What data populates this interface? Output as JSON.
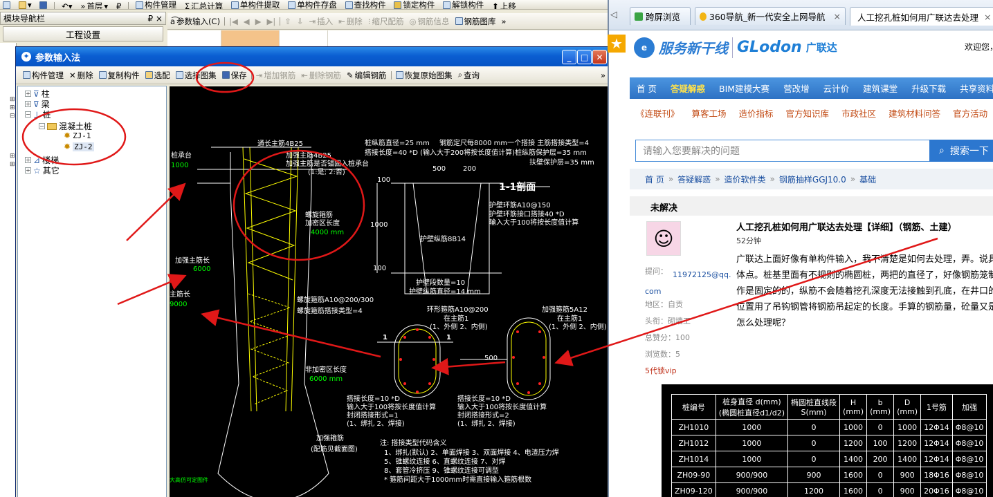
{
  "app_toolbar": {
    "floor": "首层",
    "items": [
      "构件管理",
      "汇总计算",
      "单构件提取",
      "单构件存盘",
      "查找构件",
      "锁定构件",
      "解锁构件",
      "上移"
    ]
  },
  "nav": {
    "title": "模块导航栏",
    "pin": "₽ ×",
    "project_settings": "工程设置"
  },
  "doc_toolbar": {
    "param_input": "参数输入(C)",
    "insert": "插入",
    "delete": "删除",
    "zoom": "缩尺配筋",
    "rebar_info": "钢筋信息",
    "rebar_lib": "钢筋图库"
  },
  "dialog": {
    "title": "参数输入法",
    "toolbar": {
      "component_mgmt": "构件管理",
      "delete": "删除",
      "copy": "复制构件",
      "select_rebar": "选配",
      "select_atlas": "选择图集",
      "save": "保存",
      "add_rebar": "增加钢筋",
      "remove_rebar": "删除钢筋",
      "edit_rebar": "编辑钢筋",
      "restore": "恢复原始图集",
      "query": "查询"
    },
    "tree": [
      {
        "label": "柱",
        "depth": 0
      },
      {
        "label": "梁",
        "depth": 0
      },
      {
        "label": "桩",
        "depth": 0
      },
      {
        "label": "混凝土桩",
        "depth": 1
      },
      {
        "label": "ZJ-1",
        "depth": 2
      },
      {
        "label": "ZJ-2",
        "depth": 2
      },
      {
        "label": "楼梯",
        "depth": 0
      },
      {
        "label": "其它",
        "depth": 0
      }
    ]
  },
  "cad": {
    "t_main_rebar_dia": "桩纵筋直径=25 mm",
    "t_rebar_length": "钢筋定尺每8000 mm一个搭接  主筋搭接类型=4",
    "t_lap_len": "搭接长度=40  *D (输入大于200将按长度值计算)桩纵筋保护层=35 mm",
    "t_cover": "扶壁保护层=35 mm",
    "t_through": "通长主筋4B25",
    "t_add_main": "加强主筋4B25",
    "t_anchor": "加强主筋是否锚固入桩承台",
    "t_anchor2": "(1:是; 2:否)",
    "t_cap": "桩承台",
    "t_cap_len": "1000",
    "t_spiral": "螺旋箍筋",
    "t_spiral2": "加密区长度",
    "t_spiral3": "4000 mm",
    "t_add_len": "加强主筋长",
    "t_add_len_v": "6000",
    "t_main_len": "主筋长",
    "t_main_len_v": "9000",
    "t_spiral_bar": "螺旋箍筋A10@200/300",
    "t_spiral_lap": "螺旋箍筋搭接类型=4",
    "t_nonenc": "非加密区长度",
    "t_nonenc_v": "6000 mm",
    "t_add_stirrup": "加强箍筋",
    "t_add_stirrup2": "(配筋见截面图)",
    "t_section": "1-1剖面",
    "t_d500": "500",
    "t_d200": "200",
    "t_d100a": "100",
    "t_d1000": "1000",
    "t_d100b": "100",
    "t_wall_ring": "护壁环筋A10@150",
    "t_wall_lap": "护壁环筋接口搭接40 *D",
    "t_wall_lap2": "输入大于100将按长度值计算",
    "t_wall_long": "护壁纵筋8B14",
    "t_wall_layers": "护壁段数量=10",
    "t_wall_dia": "护壁纵筋直径=14 mm",
    "t_ring": "环形箍筋A10@200",
    "t_ring_in": "在主筋1",
    "t_ring_opt": "(1、外侧  2、内侧)",
    "t_add_hoop": "加强箍筋5A12",
    "t_add_hoop_in": "在主筋1",
    "t_add_hoop_opt": "(1、外侧  2、内侧)",
    "t_500": "500",
    "t_11l": "1",
    "t_11r": "1",
    "t_lap1": "搭接长度=10  *D",
    "t_lap1b": "输入大于100将按长度值计算",
    "t_lap1c": "封闭搭接形式=1",
    "t_lap1d": "(1、绑扎  2、焊接)",
    "t_lap2": "搭接长度=10  *D",
    "t_lap2b": "输入大于100将按长度值计算",
    "t_lap2c": "封闭搭接形式=2",
    "t_lap2d": "(1、绑扎  2、焊接)",
    "t_note1": "注: 搭接类型代码含义",
    "t_note2": "1、绑扎(默认)   2、单面焊接   3、双面焊接   4、电渣压力焊",
    "t_note3": "5、锥螺纹连接   6、直螺纹连接   7、对焊",
    "t_note4": "8、套管冷挤压   9、锥螺纹连接可调型",
    "t_note5": "* 箍筋间距大于1000mm时需直接输入箍筋根数",
    "t_footer": "大高仿可定图件"
  },
  "browser": {
    "tabs": [
      "跨屏浏览",
      "360导航_新一代安全上网导航",
      "人工挖孔桩如何用广联达去处理"
    ],
    "brand1": "服务新干线",
    "brand2": "GLodon",
    "brand3": "广联达",
    "welcome": "欢迎您，",
    "nav1": [
      "首 页",
      "答疑解惑",
      "BIM建模大赛",
      "营改增",
      "云计价",
      "建筑课堂",
      "升级下载",
      "共享资料"
    ],
    "nav2": [
      "《连联刊》",
      "算客工场",
      "造价指标",
      "官方知识库",
      "市政社区",
      "建筑材料问答",
      "官方活动"
    ],
    "search_placeholder": "请输入您要解决的问题",
    "search_btn": "搜索一下",
    "crumbs": [
      "首 页",
      "答疑解惑",
      "造价软件类",
      "钢筋抽样GGJ10.0",
      "基础"
    ],
    "unresolved": "未解决",
    "q_title": "人工挖孔桩如何用广联达去处理【详细】（钢筋、土建）",
    "q_time": "52分钟",
    "asker_label": "提问：",
    "asker": "11972125@qq.com",
    "region": "地区：自贡",
    "title_label": "头衔：砌墙工",
    "score": "总赞分：100",
    "views": "浏览数：5",
    "vip": "5代锁vip",
    "q_body": "广联达上面好像有单构件输入，我不清楚是如何去处理，弄。说具体点。桩基里面有不规则的椭圆桩，两把的直径了，好像钢筋笼制作是固定的的，纵筋不会随着挖孔深度无法接触到孔底，在井口的位置用了吊钩钢管将钢筋吊起定的长度。手算的钢筋量，砼量又是怎么处理呢？",
    "table": {
      "headers": [
        "桩编号",
        "桩身直径  d(mm)\n(椭圆桩直径d1/d2)",
        "椭圆桩直线段\nS(mm)",
        "H\n(mm)",
        "b\n(mm)",
        "D\n(mm)",
        "1号筋",
        "加强"
      ],
      "rows": [
        [
          "ZH1010",
          "1000",
          "0",
          "1000",
          "0",
          "1000",
          "12Φ14",
          "Φ8@10"
        ],
        [
          "ZH1012",
          "1000",
          "0",
          "1200",
          "100",
          "1200",
          "12Φ14",
          "Φ8@10"
        ],
        [
          "ZH1014",
          "1000",
          "0",
          "1400",
          "200",
          "1400",
          "12Φ14",
          "Φ8@10"
        ],
        [
          "ZH09-90",
          "900/900",
          "900",
          "1600",
          "0",
          "900",
          "18Φ16",
          "Φ8@10"
        ],
        [
          "ZH09-120",
          "900/900",
          "1200",
          "1600",
          "0",
          "900",
          "20Φ16",
          "Φ8@10"
        ]
      ]
    }
  },
  "colors": {
    "cad_bg": "#000000",
    "cad_green": "#00ff00",
    "cad_yellow": "#ffff00",
    "cad_red": "#ff2020",
    "annot_red": "#e01818",
    "title_blue": "#0b5ed2"
  }
}
